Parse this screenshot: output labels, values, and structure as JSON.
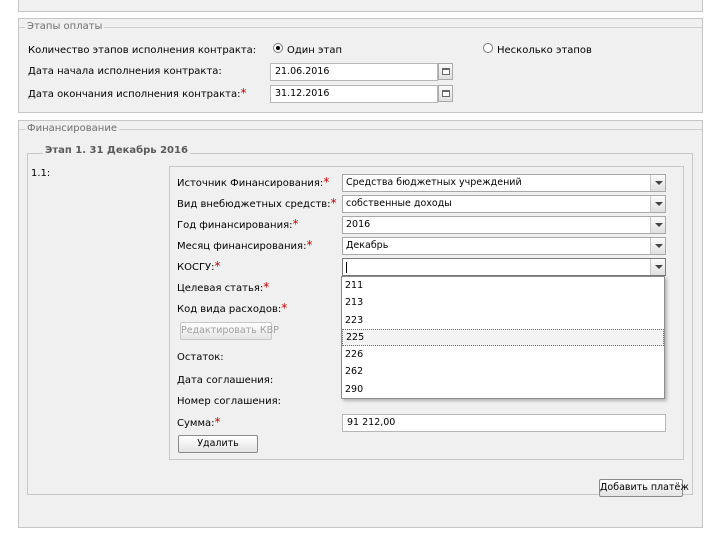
{
  "payment_stages": {
    "legend": "Этапы оплаты",
    "stages_count_label": "Количество этапов исполнения контракта:",
    "radio_one_label": "Один этап",
    "radio_one_selected": true,
    "radio_multi_label": "Несколько этапов",
    "radio_multi_selected": false,
    "start_date_label": "Дата начала исполнения контракта:",
    "start_date_value": "21.06.2016",
    "end_date_label": "Дата окончания исполнения контракта:",
    "end_date_value": "31.12.2016",
    "required_mark": "*"
  },
  "financing": {
    "legend": "Финансирование",
    "stage_legend": "Этап 1. 31 Декабрь 2016",
    "item_number": "1.1:",
    "required_mark": "*",
    "fields": {
      "source_label": "Источник Финансирования:",
      "source_value": "Средства бюджетных учреждений",
      "funds_type_label": "Вид внебюджетных средств:",
      "funds_type_value": "собственные доходы",
      "year_label": "Год финансирования:",
      "year_value": "2016",
      "month_label": "Месяц финансирования:",
      "month_value": "Декабрь",
      "kosgu_label": "КОСГУ:",
      "kosgu_value": "",
      "target_article_label": "Целевая статья:",
      "expense_code_label": "Код вида расходов:",
      "edit_kvr_button": "Редактировать КВР",
      "balance_label": "Остаток:",
      "agreement_date_label": "Дата соглашения:",
      "agreement_number_label": "Номер соглашения:",
      "sum_label": "Сумма:",
      "sum_value": "91 212,00",
      "delete_button": "Удалить"
    },
    "kosgu_options": [
      "211",
      "213",
      "223",
      "225",
      "226",
      "262",
      "290"
    ],
    "kosgu_highlighted": "225",
    "add_payment_button": "Добавить платёж"
  },
  "colors": {
    "required": "#cc0000",
    "panel_bg": "#f0f0f0",
    "legend_text": "#6e6e6e"
  }
}
